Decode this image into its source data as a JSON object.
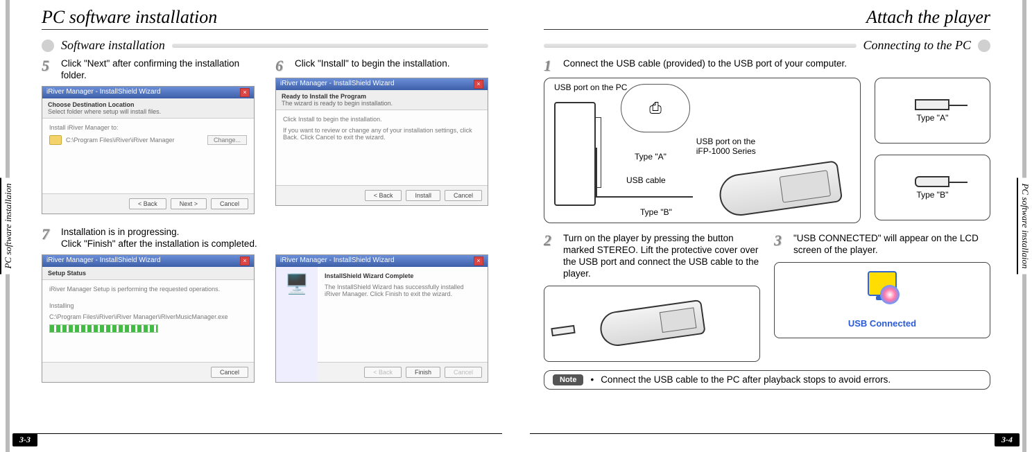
{
  "left": {
    "title": "PC software installation",
    "side_tab": "PC software installaion",
    "section": "Software installation",
    "page_num": "3-3",
    "steps": {
      "s5": {
        "n": "5",
        "text": "Click \"Next\" after confirming the installation folder."
      },
      "s6": {
        "n": "6",
        "text": "Click \"Install\" to begin the installation."
      },
      "s7": {
        "n": "7",
        "text": "Installation is in progressing.\nClick \"Finish\" after the installation is completed."
      }
    },
    "wiz": {
      "app": "iRiver Manager - InstallShield Wizard",
      "dest_title": "Choose Destination Location",
      "dest_sub": "Select folder where setup will install files.",
      "dest_label": "Install iRiver Manager to:",
      "dest_path": "C:\\Program Files\\iRiver\\iRiver Manager",
      "browse": "Change...",
      "ready_title": "Ready to Install the Program",
      "ready_sub": "The wizard is ready to begin installation.",
      "ready_body1": "Click Install to begin the installation.",
      "ready_body2": "If you want to review or change any of your installation settings, click Back. Click Cancel to exit the wizard.",
      "status_title": "Setup Status",
      "status_line": "iRiver Manager Setup is performing the requested operations.",
      "status_sub": "Installing",
      "status_path": "C:\\Program Files\\iRiver\\iRiver Manager\\iRiverMusicManager.exe",
      "done_title": "InstallShield Wizard Complete",
      "done_body": "The InstallShield Wizard has successfully installed iRiver Manager. Click Finish to exit the wizard.",
      "btn_back": "< Back",
      "btn_next": "Next >",
      "btn_install": "Install",
      "btn_cancel": "Cancel",
      "btn_finish": "Finish"
    }
  },
  "right": {
    "title": "Attach the player",
    "side_tab": "PC software installaion",
    "section": "Connecting to the PC",
    "page_num": "3-4",
    "steps": {
      "s1": {
        "n": "1",
        "text": "Connect the USB cable (provided) to the USB port of your computer."
      },
      "s2": {
        "n": "2",
        "text": "Turn on the player by pressing the button marked STEREO.  Lift the protective cover over the USB port and connect the USB cable to the player."
      },
      "s3": {
        "n": "3",
        "text": "\"USB CONNECTED\" will appear on the LCD screen of the player."
      }
    },
    "labels": {
      "usb_pc": "USB port on the PC",
      "usb_dev_1": "USB port on the",
      "usb_dev_2": "iFP-1000 Series",
      "type_a": "Type \"A\"",
      "type_b": "Type \"B\"",
      "usb_cable": "USB cable",
      "lcd": "USB Connected"
    },
    "note": {
      "pill": "Note",
      "text": "Connect the USB cable to the PC after playback stops to avoid errors."
    }
  }
}
